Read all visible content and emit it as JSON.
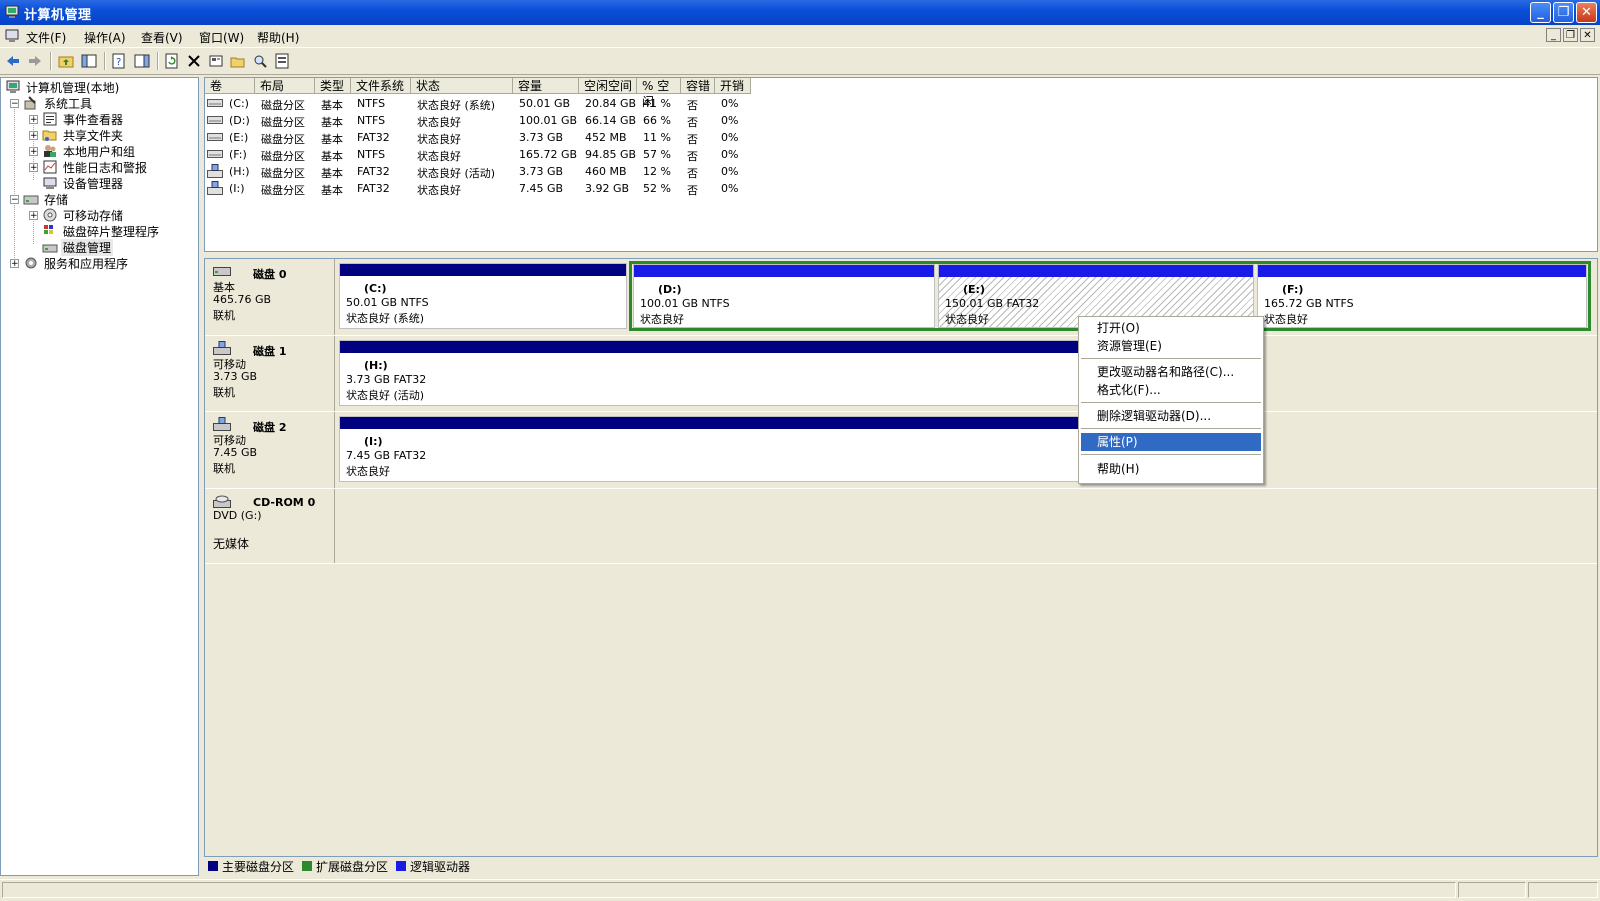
{
  "window": {
    "title": "计算机管理"
  },
  "menu": [
    "文件(F)",
    "操作(A)",
    "查看(V)",
    "窗口(W)",
    "帮助(H)"
  ],
  "tree": {
    "root": "计算机管理(本地)",
    "system_tools": "系统工具",
    "event_viewer": "事件查看器",
    "shared_folders": "共享文件夹",
    "local_users": "本地用户和组",
    "perf_logs": "性能日志和警报",
    "device_manager": "设备管理器",
    "storage": "存储",
    "removable": "可移动存储",
    "defrag": "磁盘碎片整理程序",
    "disk_mgmt": "磁盘管理",
    "services": "服务和应用程序"
  },
  "columns": [
    "卷",
    "布局",
    "类型",
    "文件系统",
    "状态",
    "容量",
    "空闲空间",
    "% 空闲",
    "容错",
    "开销"
  ],
  "volumes": [
    [
      "(C:)",
      "磁盘分区",
      "基本",
      "NTFS",
      "状态良好 (系统)",
      "50.01 GB",
      "20.84 GB",
      "41 %",
      "否",
      "0%"
    ],
    [
      "(D:)",
      "磁盘分区",
      "基本",
      "NTFS",
      "状态良好",
      "100.01 GB",
      "66.14 GB",
      "66 %",
      "否",
      "0%"
    ],
    [
      "(E:)",
      "磁盘分区",
      "基本",
      "FAT32",
      "状态良好",
      "3.73 GB",
      "452 MB",
      "11 %",
      "否",
      "0%"
    ],
    [
      "(F:)",
      "磁盘分区",
      "基本",
      "NTFS",
      "状态良好",
      "165.72 GB",
      "94.85 GB",
      "57 %",
      "否",
      "0%"
    ],
    [
      "(H:)",
      "磁盘分区",
      "基本",
      "FAT32",
      "状态良好 (活动)",
      "3.73 GB",
      "460 MB",
      "12 %",
      "否",
      "0%"
    ],
    [
      "(I:)",
      "磁盘分区",
      "基本",
      "FAT32",
      "状态良好",
      "7.45 GB",
      "3.92 GB",
      "52 %",
      "否",
      "0%"
    ]
  ],
  "disks": {
    "d0": {
      "name": "磁盘 0",
      "type": "基本",
      "size": "465.76 GB",
      "status": "联机"
    },
    "d1": {
      "name": "磁盘 1",
      "type": "可移动",
      "size": "3.73 GB",
      "status": "联机"
    },
    "d2": {
      "name": "磁盘 2",
      "type": "可移动",
      "size": "7.45 GB",
      "status": "联机"
    },
    "cd": {
      "name": "CD-ROM 0",
      "type": "DVD (G:)",
      "status": "无媒体"
    }
  },
  "parts": {
    "c": {
      "name": "(C:)",
      "info": "50.01 GB NTFS",
      "status": "状态良好 (系统)"
    },
    "d": {
      "name": "(D:)",
      "info": "100.01 GB NTFS",
      "status": "状态良好"
    },
    "e": {
      "name": "(E:)",
      "info": "150.01 GB FAT32",
      "status": "状态良好"
    },
    "f": {
      "name": "(F:)",
      "info": "165.72 GB NTFS",
      "status": "状态良好"
    },
    "h": {
      "name": "(H:)",
      "info": "3.73 GB FAT32",
      "status": "状态良好 (活动)"
    },
    "i": {
      "name": "(I:)",
      "info": "7.45 GB FAT32",
      "status": "状态良好"
    }
  },
  "context_menu": {
    "open": "打开(O)",
    "explore": "资源管理(E)",
    "change_letter": "更改驱动器名和路径(C)...",
    "format": "格式化(F)...",
    "delete": "删除逻辑驱动器(D)...",
    "properties": "属性(P)",
    "help": "帮助(H)"
  },
  "legend": {
    "primary": "主要磁盘分区",
    "extended": "扩展磁盘分区",
    "logical": "逻辑驱动器"
  },
  "colors": {
    "primary": "#000080",
    "extended": "#2C8A2C",
    "logical": "#1A1AE6",
    "highlight": "#316AC5"
  }
}
